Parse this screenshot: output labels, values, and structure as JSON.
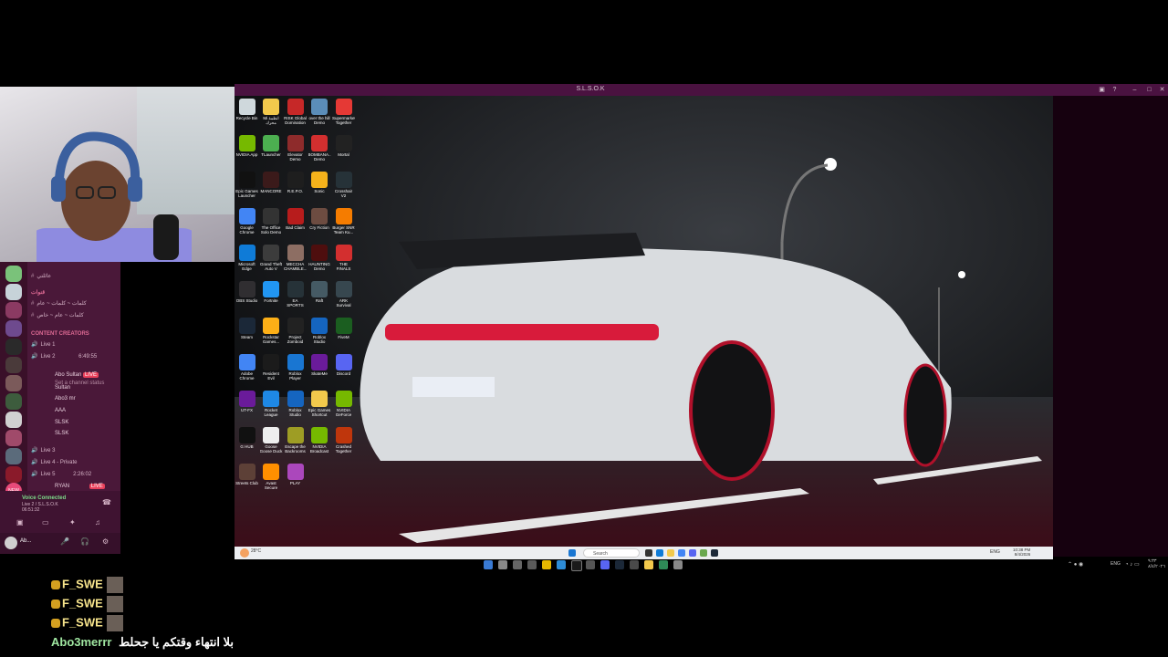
{
  "window": {
    "title": "S.L.S.O.K"
  },
  "desktop_icons": [
    {
      "label": "Recycle Bin",
      "color": "#cfd8dc"
    },
    {
      "label": "Mi أنظمة محرك",
      "color": "#f2c94c"
    },
    {
      "label": "RISK Global Domination",
      "color": "#c62828"
    },
    {
      "label": "over the hill Demo",
      "color": "#5b8db8"
    },
    {
      "label": "Supermarket Together",
      "color": "#e53935"
    },
    {
      "label": "NVIDIA App",
      "color": "#76b900"
    },
    {
      "label": "TLauncher",
      "color": "#4caf50"
    },
    {
      "label": "Elevator Demo",
      "color": "#8e2b2b"
    },
    {
      "label": "BOMBANA... Demo",
      "color": "#d32f2f"
    },
    {
      "label": "Mortal",
      "color": "#222222"
    },
    {
      "label": "Epic Games Launcher",
      "color": "#111111"
    },
    {
      "label": "MANCORE",
      "color": "#3b1a1a"
    },
    {
      "label": "R.E.P.O.",
      "color": "#1e1e1e"
    },
    {
      "label": "Sonic",
      "color": "#f5b21b"
    },
    {
      "label": "Crosshair V2",
      "color": "#263238"
    },
    {
      "label": "Google Chrome",
      "color": "#4285f4"
    },
    {
      "label": "The Office Solo Demo",
      "color": "#333333"
    },
    {
      "label": "Bad Claim",
      "color": "#b71c1c"
    },
    {
      "label": "Cry Fiction",
      "color": "#6d4c41"
    },
    {
      "label": "Burger SNR Team Ku...",
      "color": "#f57c00"
    },
    {
      "label": "Microsoft Edge",
      "color": "#0f7bd7"
    },
    {
      "label": "Grand Theft Auto V",
      "color": "#3c3c3c"
    },
    {
      "label": "MECCHA CHAMBLE...",
      "color": "#8d6e63"
    },
    {
      "label": "HAUNTING Demo",
      "color": "#4e0e0e"
    },
    {
      "label": "THE FINALS",
      "color": "#d32f2f"
    },
    {
      "label": "OBS Studio",
      "color": "#302e31"
    },
    {
      "label": "Fortnite",
      "color": "#2196f3"
    },
    {
      "label": "EA SPORTS FC 26",
      "color": "#263238"
    },
    {
      "label": "Raft",
      "color": "#455a64"
    },
    {
      "label": "ARK Survival Evolved",
      "color": "#37474f"
    },
    {
      "label": "Steam",
      "color": "#1b2838"
    },
    {
      "label": "Rockstar Games...",
      "color": "#fcaf17"
    },
    {
      "label": "Project Zomboid Demo",
      "color": "#222222"
    },
    {
      "label": "Roblox Studio",
      "color": "#1565c0"
    },
    {
      "label": "FiveM",
      "color": "#1b5e20"
    },
    {
      "label": "Adobe Chrome",
      "color": "#4285f4"
    },
    {
      "label": "Resident Evil",
      "color": "#1b1b1b"
    },
    {
      "label": "Roblox Player",
      "color": "#1976d2"
    },
    {
      "label": "SkateMe",
      "color": "#6a1b9a"
    },
    {
      "label": "Discord",
      "color": "#5865f2"
    },
    {
      "label": "UT-FX",
      "color": "#6a1b9a"
    },
    {
      "label": "Rocket League",
      "color": "#1e88e5"
    },
    {
      "label": "Roblox Studio",
      "color": "#1565c0"
    },
    {
      "label": "Epic Games Shortcut",
      "color": "#f2c94c"
    },
    {
      "label": "NVIDIA GeForce",
      "color": "#76b900"
    },
    {
      "label": "G HUB",
      "color": "#111111"
    },
    {
      "label": "Goose Goose Duck",
      "color": "#eeeeee"
    },
    {
      "label": "Escape the Backrooms",
      "color": "#9e9d24"
    },
    {
      "label": "NVIDIA Broadcast",
      "color": "#76b900"
    },
    {
      "label": "Crashed Together",
      "color": "#bf360c"
    },
    {
      "label": "Streets Club",
      "color": "#5d4037"
    },
    {
      "label": "Avast Secure Booster",
      "color": "#ff8f00"
    },
    {
      "label": "PLAY",
      "color": "#ab47bc"
    }
  ],
  "sidebar": {
    "channels": [
      {
        "label": "عائلتي",
        "type": "text"
      },
      {
        "label": "قنوات",
        "type": "category"
      },
      {
        "label": "كلمات ~ كلمات ~ عام",
        "type": "text"
      },
      {
        "label": "كلمات ~ عام ~ خاص",
        "type": "text"
      },
      {
        "label": "CONTENT CREATORS",
        "type": "category"
      },
      {
        "label": "Live 1",
        "type": "voice"
      },
      {
        "label": "Live 2",
        "type": "voice",
        "time": "6:49:55"
      },
      {
        "label": "Abo Sultan",
        "type": "user",
        "badge": "LIVE"
      },
      {
        "label": "Set a channel status",
        "type": "note"
      },
      {
        "label": "Sultan",
        "type": "user"
      },
      {
        "label": "Abo3 mr",
        "type": "user"
      },
      {
        "label": "AAA",
        "type": "user"
      },
      {
        "label": "SLSK",
        "type": "user"
      },
      {
        "label": "SLSK",
        "type": "user"
      },
      {
        "label": "Live 3",
        "type": "voice"
      },
      {
        "label": "Live 4 - Private",
        "type": "voice"
      },
      {
        "label": "Live 5",
        "type": "voice",
        "time": "2:26:02"
      },
      {
        "label": "RYAN",
        "type": "user",
        "badge": "LIVE"
      }
    ],
    "voice": {
      "status": "Voice Connected",
      "channel": "Live 2 / S.L.S.O.K",
      "time": "06:51:32"
    },
    "user": {
      "name": "Ab..."
    },
    "new_badge": "NEW"
  },
  "taskbar": {
    "search_placeholder": "Search",
    "weather": "28°C",
    "time": "10:38 PM",
    "date": "8/4/2026",
    "lang": "ENG"
  },
  "host_taskbar": {
    "lang": "ENG",
    "time": "٩:٣٣",
    "date": "٨/٤/٢٠٢٦"
  },
  "chat": [
    {
      "user": "F_SWE"
    },
    {
      "user": "F_SWE"
    },
    {
      "user": "F_SWE"
    },
    {
      "user": "Abo3merrr",
      "message": "بلا انتهاء وقتكم يا جحلط"
    }
  ],
  "colors": {
    "accent": "#4a1240",
    "chat_name": "#f6e38b",
    "chat_user_green": "#9fe6a0"
  }
}
